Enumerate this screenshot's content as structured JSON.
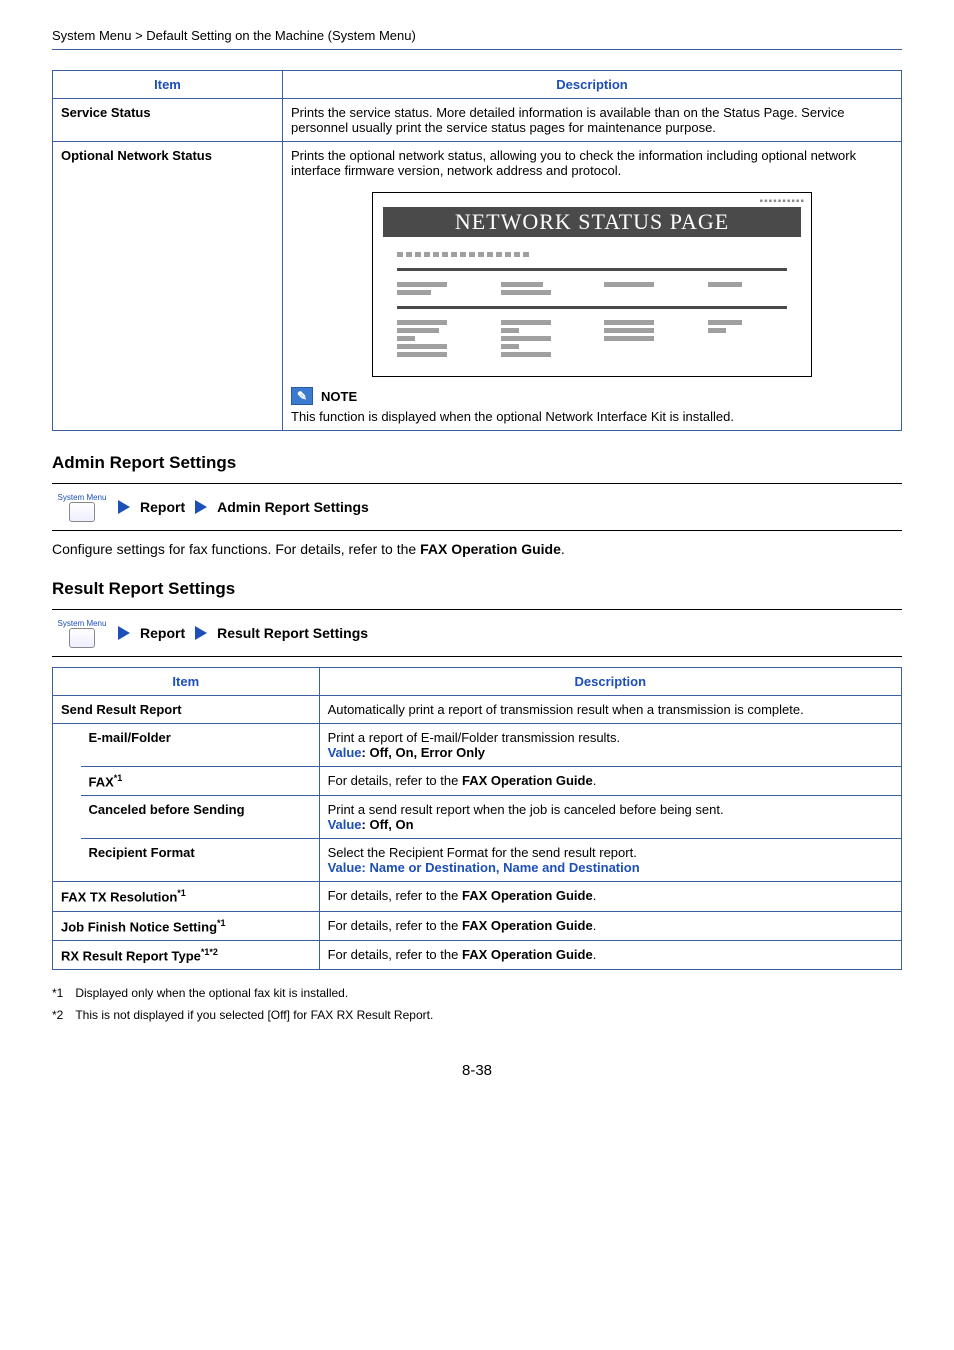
{
  "breadcrumb": "System Menu > Default Setting on the Machine (System Menu)",
  "table1": {
    "head_item": "Item",
    "head_desc": "Description",
    "rows": [
      {
        "item": "Service Status",
        "desc": "Prints the service status. More detailed information is available than on the Status Page. Service personnel usually print the service status pages for maintenance purpose."
      },
      {
        "item": "Optional Network Status",
        "desc": "Prints the optional network status, allowing you to check the information including optional network interface firmware version, network address and protocol.",
        "illus_title": "NETWORK STATUS PAGE",
        "note_label": "NOTE",
        "note_text": "This function is displayed when the optional Network Interface Kit is installed."
      }
    ]
  },
  "admin_section": {
    "heading": "Admin Report Settings",
    "nav": {
      "sys": "System Menu",
      "s1": "Report",
      "s2": "Admin Report Settings"
    },
    "body_pre": "Configure settings for fax functions. For details, refer to the ",
    "body_ref": "FAX Operation Guide",
    "body_post": "."
  },
  "result_section": {
    "heading": "Result Report Settings",
    "nav": {
      "sys": "System Menu",
      "s1": "Report",
      "s2": "Result Report Settings"
    },
    "head_item": "Item",
    "head_desc": "Description",
    "rows": {
      "send": {
        "item": "Send Result Report",
        "desc": "Automatically print a report of transmission result when a transmission is complete."
      },
      "email": {
        "item": "E-mail/Folder",
        "desc": "Print a report of E-mail/Folder transmission results.",
        "val_label": "Value",
        "val": ": Off, On, Error Only"
      },
      "fax": {
        "item": "FAX",
        "sup": "*1",
        "desc_pre": "For details, refer to the ",
        "desc_ref": "FAX Operation Guide",
        "desc_post": "."
      },
      "canceled": {
        "item": "Canceled before Sending",
        "desc": "Print a send result report when the job is canceled before being sent.",
        "val_label": "Value",
        "val": ": Off, On"
      },
      "recipient": {
        "item": "Recipient Format",
        "desc": "Select the Recipient Format for the send result report.",
        "val_label": "Value",
        "val": ": Name or Destination, Name and Destination"
      },
      "txres": {
        "item": "FAX TX Resolution",
        "sup": "*1",
        "desc_pre": "For details, refer to the ",
        "desc_ref": "FAX Operation Guide",
        "desc_post": "."
      },
      "jobfin": {
        "item": "Job Finish Notice Setting",
        "sup": "*1",
        "desc_pre": "For details, refer to the ",
        "desc_ref": "FAX Operation Guide",
        "desc_post": "."
      },
      "rxres": {
        "item": "RX Result Report Type",
        "sup": "*1*2",
        "desc_pre": "For details, refer to the ",
        "desc_ref": "FAX Operation Guide",
        "desc_post": "."
      }
    }
  },
  "footnotes": {
    "f1k": "*1",
    "f1": "Displayed only when the optional fax kit is installed.",
    "f2k": "*2",
    "f2": "This is not displayed if you selected [Off] for FAX RX Result Report."
  },
  "page_num": "8-38"
}
